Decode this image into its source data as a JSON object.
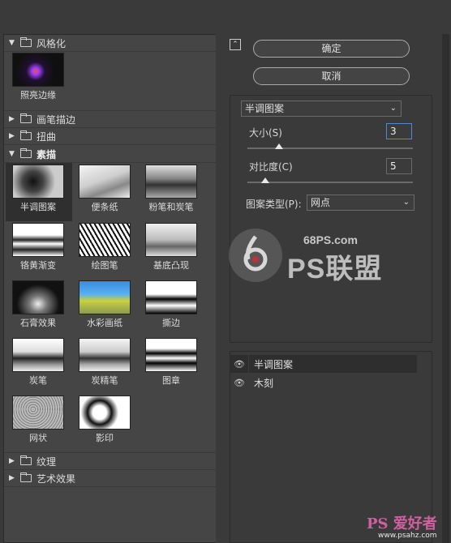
{
  "categories": {
    "stylize": {
      "label": "风格化",
      "expanded": true
    },
    "brush": {
      "label": "画笔描边",
      "expanded": false
    },
    "distort": {
      "label": "扭曲",
      "expanded": false
    },
    "sketch": {
      "label": "素描",
      "expanded": true
    },
    "texture": {
      "label": "纹理",
      "expanded": false
    },
    "artistic": {
      "label": "艺术效果",
      "expanded": false
    }
  },
  "stylize_filters": [
    {
      "label": "照亮边缘"
    }
  ],
  "sketch_filters": [
    {
      "label": "半调图案",
      "selected": true
    },
    {
      "label": "便条纸"
    },
    {
      "label": "粉笔和炭笔"
    },
    {
      "label": "铬黄渐变"
    },
    {
      "label": "绘图笔"
    },
    {
      "label": "基底凸现"
    },
    {
      "label": "石膏效果"
    },
    {
      "label": "水彩画纸"
    },
    {
      "label": "撕边"
    },
    {
      "label": "炭笔"
    },
    {
      "label": "炭精笔"
    },
    {
      "label": "图章"
    },
    {
      "label": "网状"
    },
    {
      "label": "影印"
    }
  ],
  "buttons": {
    "ok": "确定",
    "cancel": "取消",
    "collapse": "⌃"
  },
  "settings": {
    "filter_select": "半调图案",
    "size_label": "大小(S)",
    "size_value": "3",
    "size_fraction": 0.15,
    "contrast_label": "对比度(C)",
    "contrast_value": "5",
    "contrast_fraction": 0.1,
    "pattern_label": "图案类型(P):",
    "pattern_value": "网点"
  },
  "layers": [
    {
      "label": "半调图案",
      "active": true
    },
    {
      "label": "木刻",
      "active": false
    }
  ],
  "watermark": {
    "site": "68PS.com",
    "brand": "PS联盟",
    "corner": "PS 爱好者",
    "corner_url": "www.psahz.com"
  },
  "colors": {
    "panel": "#454545",
    "bg": "#3a3a3a",
    "focus": "#4d8ad0",
    "selected": "#2f2f2f"
  }
}
